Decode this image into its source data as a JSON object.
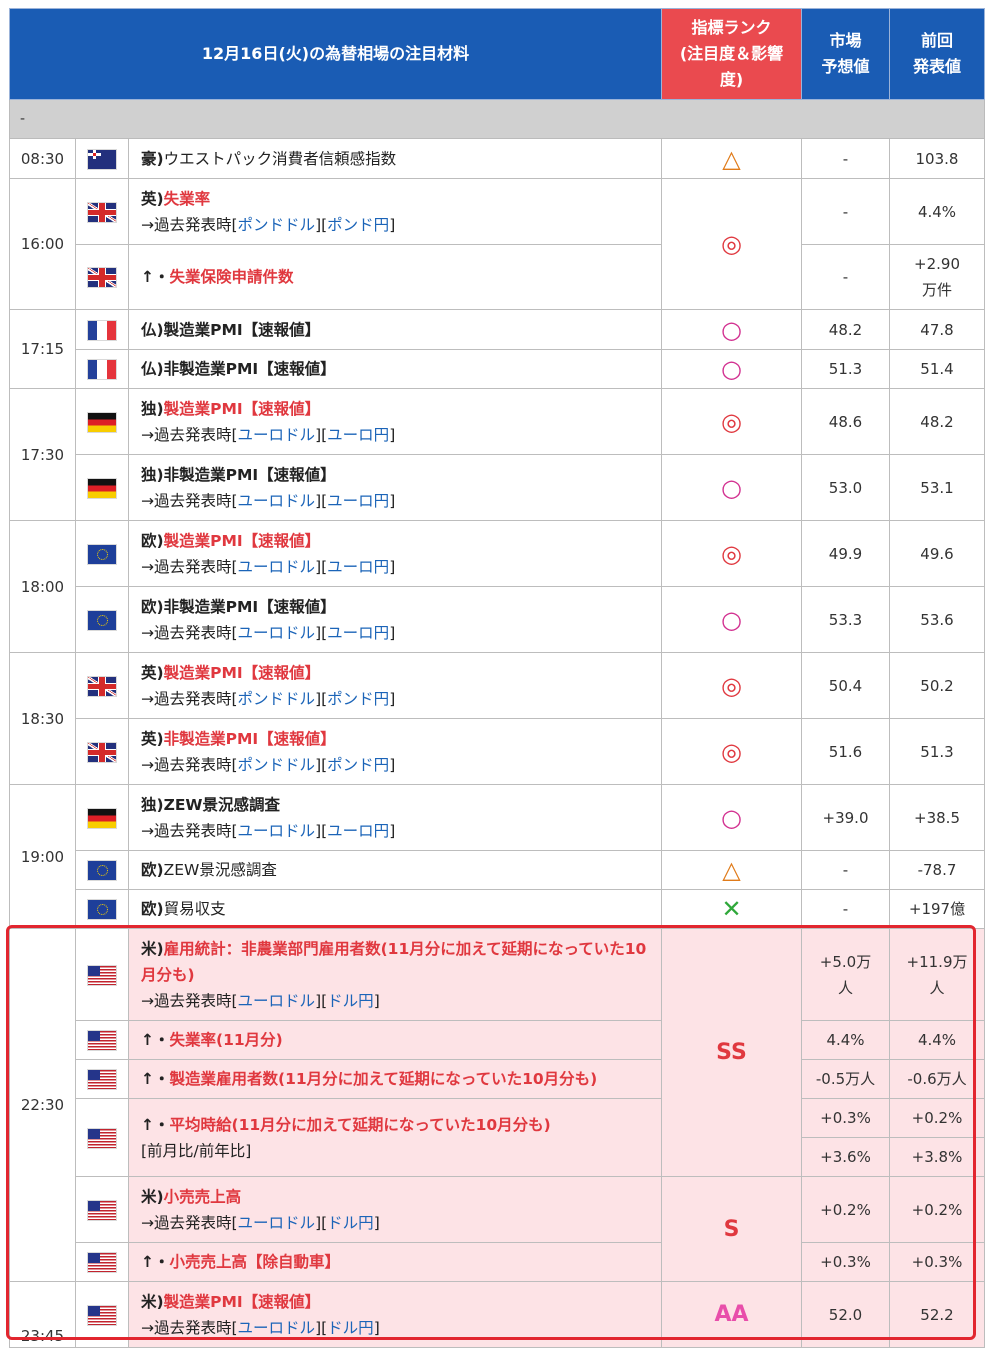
{
  "header": {
    "title": "12月16日(火)の為替相場の注目材料",
    "rank_line1": "指標ランク",
    "rank_line2": "(注目度＆影響",
    "rank_line3": "度)",
    "forecast_line1": "市場",
    "forecast_line2": "予想値",
    "previous_line1": "前回",
    "previous_line2": "発表値"
  },
  "section_label": "-",
  "common": {
    "past_prefix": "→過去発表時[",
    "mid": "][",
    "end": "]",
    "arrow": "↑・",
    "pound_usd": "ポンドドル",
    "pound_jpy": "ポンド円",
    "euro_usd": "ユーロドル",
    "euro_jpy": "ユーロ円",
    "usd_jpy": "ドル円"
  },
  "rows": {
    "r1": {
      "time": "08:30",
      "country": "豪)",
      "name": "ウエストパック消費者信頼感指数",
      "forecast": "-",
      "previous": "103.8",
      "rank": "△"
    },
    "r2": {
      "time": "16:00",
      "country": "英)",
      "name": "失業率",
      "forecast": "-",
      "previous": "4.4%",
      "rank": "◎"
    },
    "r3": {
      "name": "失業保険申請件数",
      "forecast": "-",
      "previous": "+2.90万件"
    },
    "r4": {
      "time": "17:15",
      "country": "仏)",
      "name": "製造業PMI【速報値】",
      "forecast": "48.2",
      "previous": "47.8",
      "rank": "○"
    },
    "r5": {
      "country": "仏)",
      "name": "非製造業PMI【速報値】",
      "forecast": "51.3",
      "previous": "51.4",
      "rank": "○"
    },
    "r6": {
      "time": "17:30",
      "country": "独)",
      "name": "製造業PMI【速報値】",
      "forecast": "48.6",
      "previous": "48.2",
      "rank": "◎"
    },
    "r7": {
      "country": "独)",
      "name": "非製造業PMI【速報値】",
      "forecast": "53.0",
      "previous": "53.1",
      "rank": "○"
    },
    "r8": {
      "time": "18:00",
      "country": "欧)",
      "name": "製造業PMI【速報値】",
      "forecast": "49.9",
      "previous": "49.6",
      "rank": "◎"
    },
    "r9": {
      "country": "欧)",
      "name": "非製造業PMI【速報値】",
      "forecast": "53.3",
      "previous": "53.6",
      "rank": "○"
    },
    "r10": {
      "time": "18:30",
      "country": "英)",
      "name": "製造業PMI【速報値】",
      "forecast": "50.4",
      "previous": "50.2",
      "rank": "◎"
    },
    "r11": {
      "country": "英)",
      "name": "非製造業PMI【速報値】",
      "forecast": "51.6",
      "previous": "51.3",
      "rank": "◎"
    },
    "r12": {
      "time": "19:00",
      "country": "独)",
      "name": "ZEW景況感調査",
      "forecast": "+39.0",
      "previous": "+38.5",
      "rank": "○"
    },
    "r13": {
      "country": "欧)",
      "name": "ZEW景況感調査",
      "forecast": "-",
      "previous": "-78.7",
      "rank": "△"
    },
    "r14": {
      "country": "欧)",
      "name": "貿易収支",
      "forecast": "-",
      "previous": "+197億",
      "rank": "✕"
    },
    "r15": {
      "time": "22:30",
      "country": "米)",
      "name": "雇用統計：非農業部門雇用者数(11月分に加えて延期になっていた10月分も)",
      "forecast": "+5.0万人",
      "previous": "+11.9万人",
      "rank": "SS"
    },
    "r16": {
      "name": "失業率(11月分)",
      "forecast": "4.4%",
      "previous": "4.4%"
    },
    "r17": {
      "name": "製造業雇用者数(11月分に加えて延期になっていた10月分も)",
      "forecast": "-0.5万人",
      "previous": "-0.6万人"
    },
    "r18": {
      "name": "平均時給(11月分に加えて延期になっていた10月分も)",
      "note": "[前月比/前年比]",
      "forecast": "+0.3%",
      "previous": "+0.2%",
      "forecast2": "+3.6%",
      "previous2": "+3.8%"
    },
    "r19": {
      "country": "米)",
      "name": "小売売上高",
      "forecast": "+0.2%",
      "previous": "+0.2%",
      "rank": "S"
    },
    "r20": {
      "name": "小売売上高【除自動車】",
      "forecast": "+0.3%",
      "previous": "+0.3%"
    },
    "r21": {
      "time": "23:45",
      "country": "米)",
      "name": "製造業PMI【速報値】",
      "forecast": "52.0",
      "previous": "52.2",
      "rank": "AA"
    }
  },
  "colors": {
    "header_blue": "#1a5cb4",
    "rank_red": "#ea4a4f",
    "highlight_pink": "#fde3e6",
    "link_blue": "#1b64b8",
    "accent_red": "#e0383f"
  }
}
